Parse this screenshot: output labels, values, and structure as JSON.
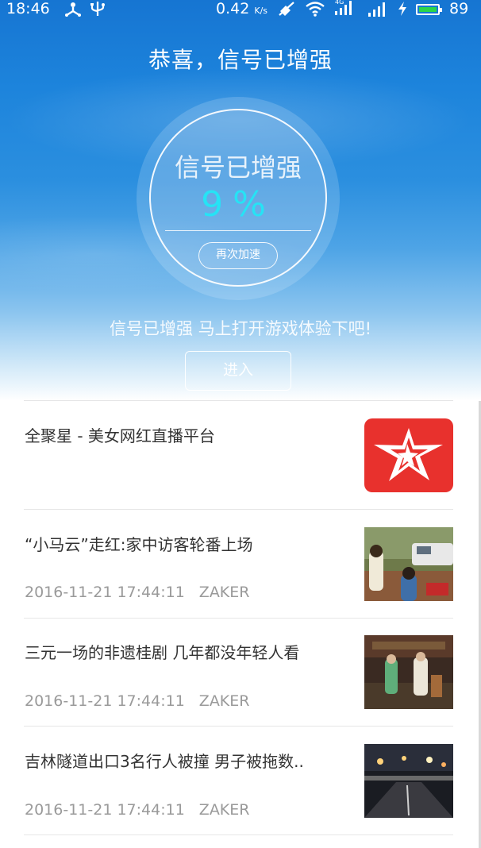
{
  "status_bar": {
    "time": "18:46",
    "speed": "0.42",
    "speed_unit": "K/s",
    "network": "4G",
    "battery": "89",
    "icons": [
      "usb-share-icon",
      "usb-icon",
      "mute-icon",
      "wifi-icon",
      "signal-icon",
      "signal-icon",
      "charging-icon",
      "battery-icon"
    ]
  },
  "header": {
    "title": "恭喜，信号已增强"
  },
  "gauge": {
    "label": "信号已增强",
    "value": "9",
    "unit": "%",
    "button": "再次加速"
  },
  "hint": "信号已增强 马上打开游戏体验下吧!",
  "enter_button": "进入",
  "ad": {
    "title": "全聚星 - 美女网红直播平台",
    "logo": "star-logo"
  },
  "news": [
    {
      "title": "“小马云”走红:家中访客轮番上场",
      "time": "2016-11-21 17:44:11",
      "source": "ZAKER"
    },
    {
      "title": "三元一场的非遗桂剧 几年都没年轻人看",
      "time": "2016-11-21 17:44:11",
      "source": "ZAKER"
    },
    {
      "title": "吉林隧道出口3名行人被撞 男子被拖数..",
      "time": "2016-11-21 17:44:11",
      "source": "ZAKER"
    }
  ],
  "colors": {
    "accent_cyan": "#26e3f5",
    "ad_red": "#e8312d",
    "battery_green": "#2bd64a"
  }
}
